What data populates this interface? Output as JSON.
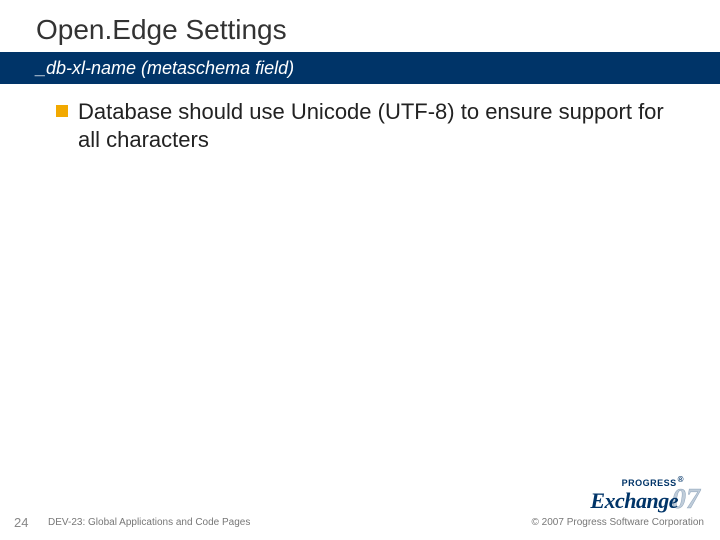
{
  "header": {
    "title": "Open.Edge Settings",
    "subtitle": "_db-xl-name (metaschema field)"
  },
  "content": {
    "bullet1": "Database should use Unicode (UTF-8) to ensure support for all characters"
  },
  "footer": {
    "page_number": "24",
    "session": "DEV-23: Global Applications and Code Pages",
    "copyright": "© 2007 Progress Software Corporation"
  },
  "logo": {
    "top": "PROGRESS",
    "main": "Exchange",
    "reg": "®",
    "year": "07"
  }
}
